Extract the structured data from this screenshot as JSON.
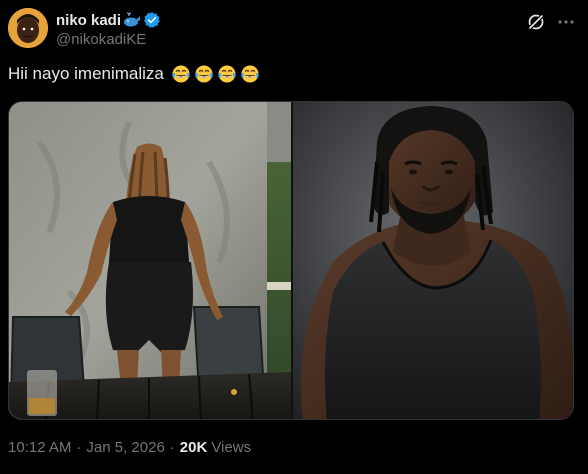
{
  "author": {
    "display_name": "niko kadi",
    "handle": "@nikokadiKE",
    "verified": true
  },
  "tweet": {
    "text": "Hii nayo imenimaliza",
    "emoji_count": 4,
    "emoji_name": "face-with-tears-of-joy"
  },
  "media": {
    "photos": [
      {
        "subject": "woman-from-behind"
      },
      {
        "subject": "wrestler-portrait"
      }
    ]
  },
  "meta": {
    "time": "10:12 AM",
    "separator": "·",
    "date": "Jan 5, 2026",
    "views_count": "20K",
    "views_label": "Views"
  },
  "icons": {
    "grok": "grok-icon",
    "more": "more-icon",
    "verified": "verified-badge-icon",
    "name_emoji": "whale-emoji-icon"
  },
  "colors": {
    "background": "#000000",
    "text": "#e7e9ea",
    "secondary_text": "#71767b",
    "verified_blue": "#1d9bf0",
    "border": "#2f3336"
  }
}
